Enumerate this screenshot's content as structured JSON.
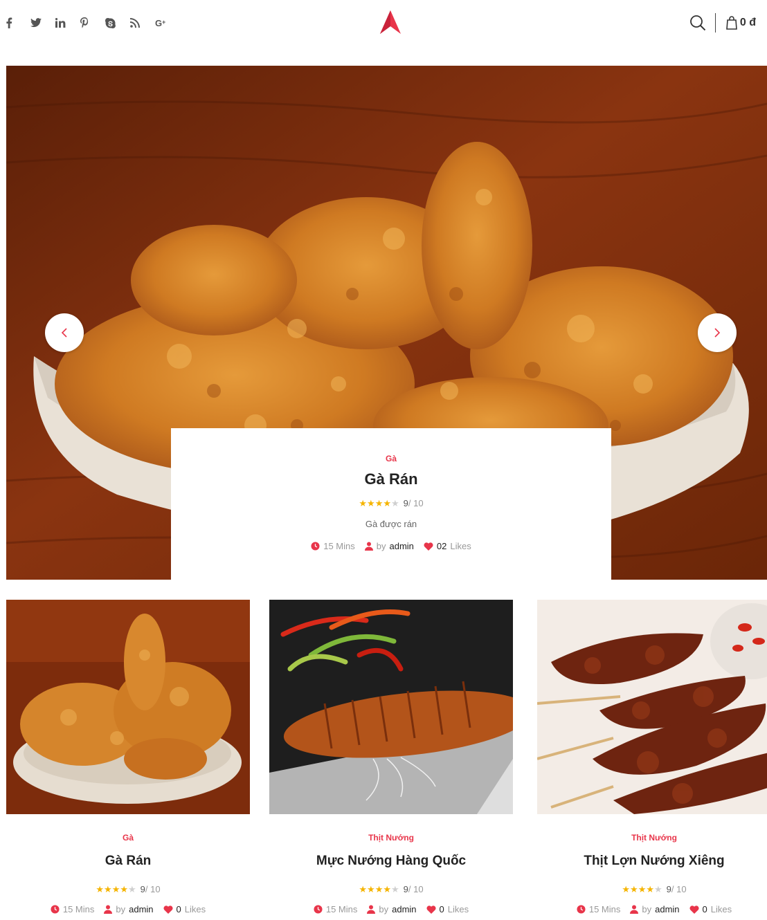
{
  "header": {
    "socials": [
      "facebook-icon",
      "twitter-icon",
      "linkedin-icon",
      "pinterest-icon",
      "skype-icon",
      "rss-icon",
      "google-plus-icon"
    ],
    "cart_total": "0 đ",
    "accent": "#e8354a"
  },
  "hero": {
    "category": "Gà",
    "title": "Gà Rán",
    "rating": "9",
    "rating_max": "/ 10",
    "stars": 4,
    "description": "Gà được rán",
    "time": "15 Mins",
    "by": "by",
    "author": "admin",
    "likes_count": "02",
    "likes_label": "Likes"
  },
  "cards": [
    {
      "category": "Gà",
      "title": "Gà Rán",
      "rating": "9",
      "rating_max": "/ 10",
      "stars": 4,
      "time": "15 Mins",
      "by": "by",
      "author": "admin",
      "likes_count": "0",
      "likes_label": "Likes"
    },
    {
      "category": "Thịt Nướng",
      "title": "Mực Nướng Hàng Quốc",
      "rating": "9",
      "rating_max": "/ 10",
      "stars": 4,
      "time": "15 Mins",
      "by": "by",
      "author": "admin",
      "likes_count": "0",
      "likes_label": "Likes"
    },
    {
      "category": "Thịt Nướng",
      "title": "Thịt Lợn Nướng Xiêng",
      "rating": "9",
      "rating_max": "/ 10",
      "stars": 4,
      "time": "15 Mins",
      "by": "by",
      "author": "admin",
      "likes_count": "0",
      "likes_label": "Likes"
    }
  ]
}
